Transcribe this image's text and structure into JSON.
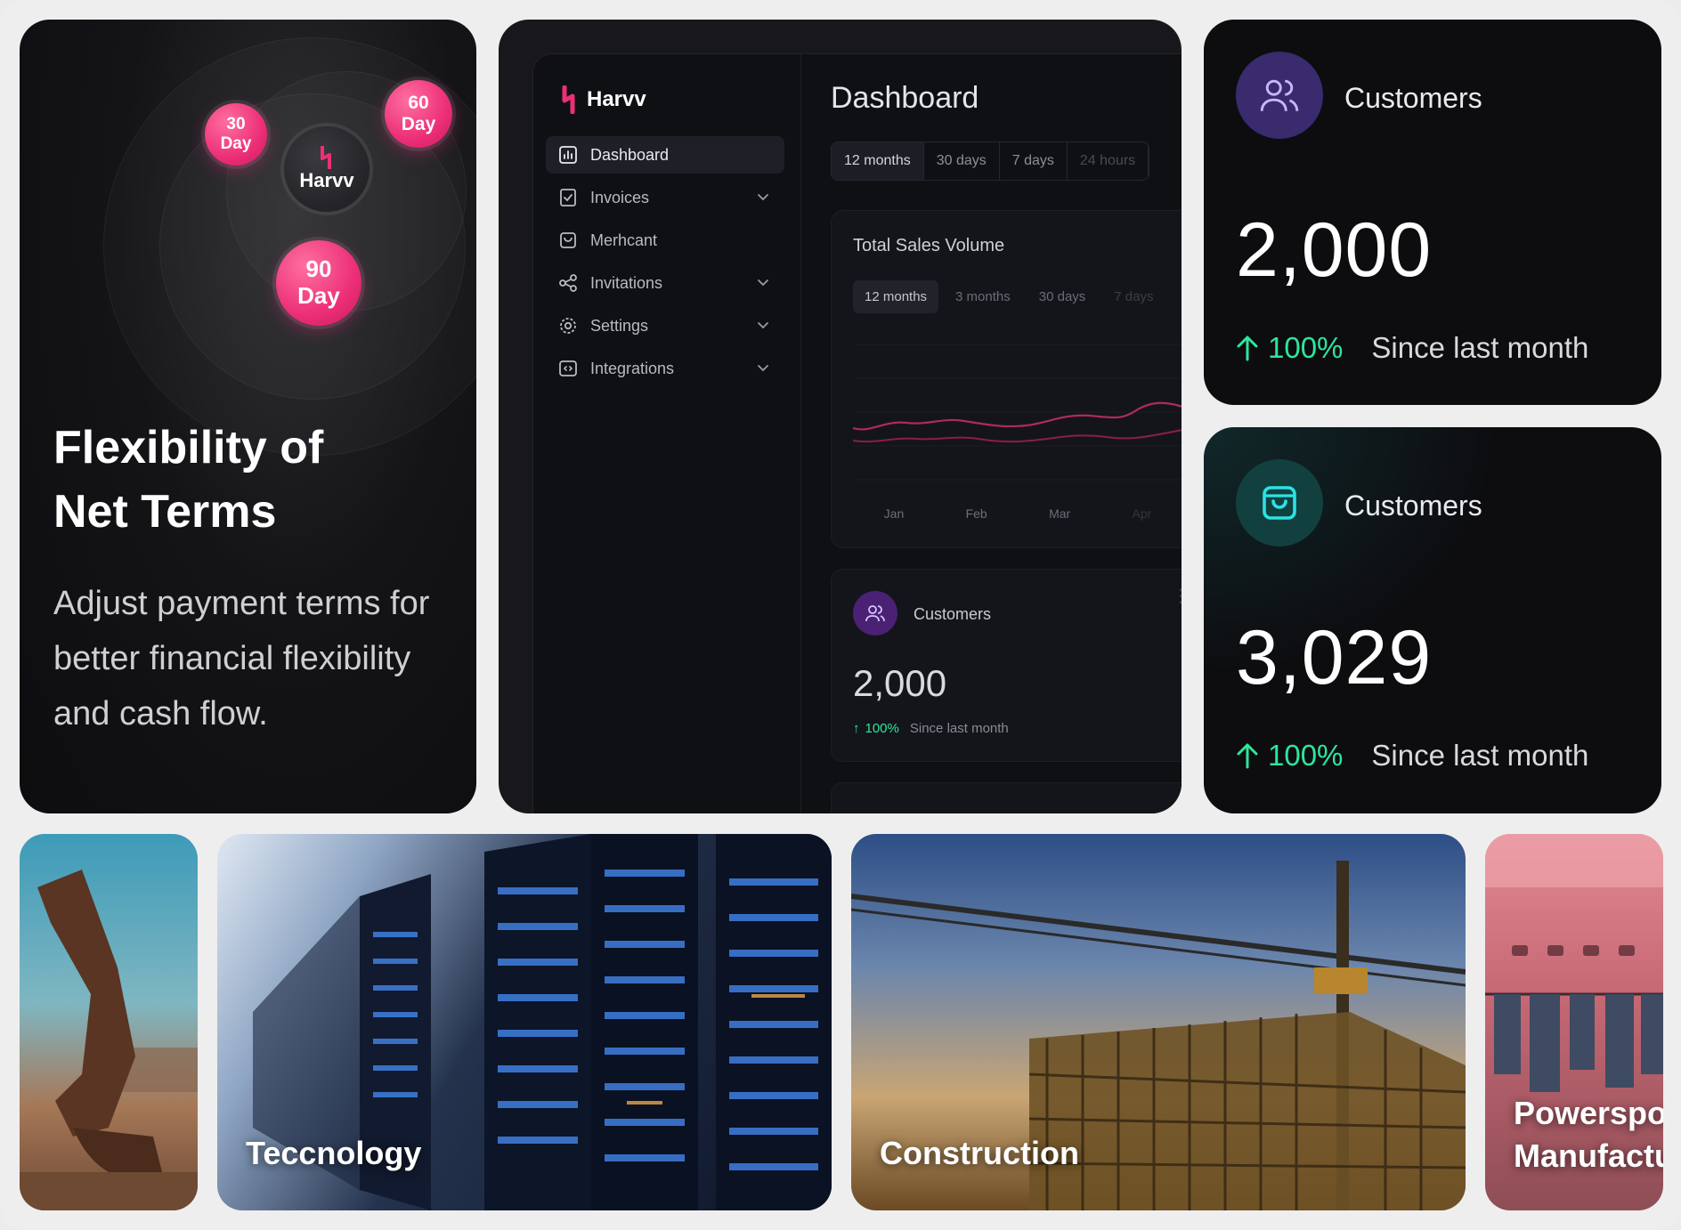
{
  "netterms": {
    "bubbles": {
      "day30_num": "30",
      "day30_unit": "Day",
      "day60_num": "60",
      "day60_unit": "Day",
      "day90_num": "90",
      "day90_unit": "Day",
      "center": "Harvv"
    },
    "title_line1": "Flexibility of",
    "title_line2": "Net Terms",
    "description": "Adjust payment terms for better financial flexibility and cash flow."
  },
  "app": {
    "brand": "Harvv",
    "nav": [
      {
        "label": "Dashboard",
        "icon": "bar-chart-icon",
        "active": true
      },
      {
        "label": "Invoices",
        "icon": "invoice-icon",
        "has_chevron": true
      },
      {
        "label": "Merhcant",
        "icon": "shopping-bag-icon"
      },
      {
        "label": "Invitations",
        "icon": "share-icon",
        "has_chevron": true
      },
      {
        "label": "Settings",
        "icon": "gear-icon",
        "has_chevron": true
      },
      {
        "label": "Integrations",
        "icon": "code-icon",
        "has_chevron": true
      }
    ],
    "page_title": "Dashboard",
    "range_tabs": [
      "12 months",
      "30 days",
      "7 days",
      "24 hours"
    ],
    "sales_panel": {
      "title": "Total Sales Volume",
      "tabs": [
        "12 months",
        "3 months",
        "30 days",
        "7 days"
      ],
      "x_labels": [
        "Jan",
        "Feb",
        "Mar",
        "Apr"
      ]
    },
    "customers_panel": {
      "label": "Customers",
      "value": "2,000",
      "change": "100%",
      "since": "Since last month"
    }
  },
  "stats": [
    {
      "label": "Customers",
      "value": "2,000",
      "change": "100%",
      "since": "Since last month",
      "icon": "users-icon",
      "accent": "#3a2a6e"
    },
    {
      "label": "Customers",
      "value": "3,029",
      "change": "100%",
      "since": "Since last month",
      "icon": "shopping-bag-icon",
      "accent": "#12403f"
    }
  ],
  "tiles": [
    {
      "label": ""
    },
    {
      "label": "Teccnology"
    },
    {
      "label": "Construction"
    },
    {
      "label_line1": "Powerspor",
      "label_line2": "Manufactu"
    }
  ],
  "colors": {
    "pink": "#ec2f77",
    "green": "#2ee59d",
    "purple": "#3a2a6e",
    "teal": "#12403f"
  }
}
